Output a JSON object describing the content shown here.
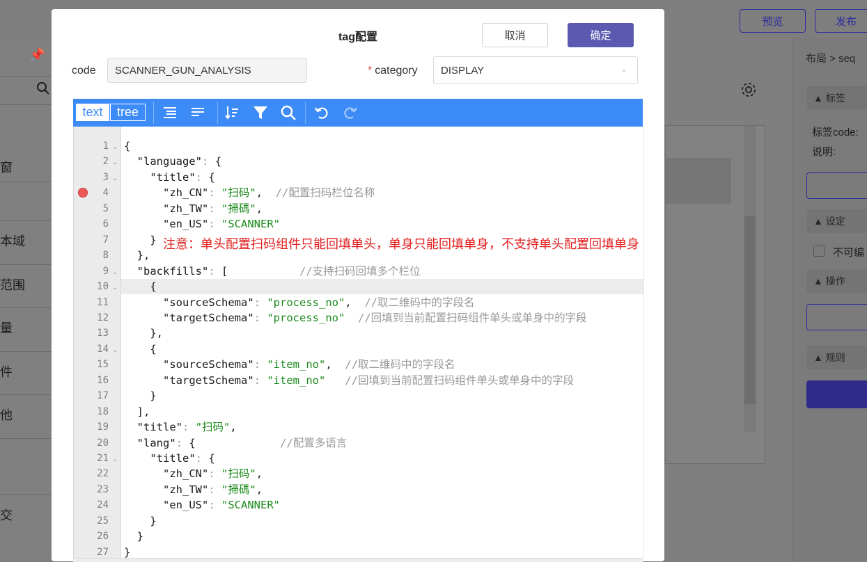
{
  "background": {
    "top_buttons": [
      "预览",
      "发布"
    ],
    "left_items": [
      "窗",
      "本域",
      "范围",
      "量",
      "件",
      "他",
      "交"
    ],
    "right_panel": {
      "breadcrumb": "布局 > seq",
      "sections": [
        "标签",
        "设定",
        "操作",
        "规则"
      ],
      "tag_code_label": "标签code:",
      "desc_label": "说明:",
      "checkbox_label": "不可编"
    }
  },
  "modal": {
    "title": "tag配置",
    "cancel_label": "取消",
    "ok_label": "确定",
    "code_label": "code",
    "code_value": "SCANNER_GUN_ANALYSIS",
    "category_label": "category",
    "category_value": "DISPLAY"
  },
  "editor": {
    "modes": [
      "text",
      "tree"
    ],
    "toolbar_icons": [
      "format-icon",
      "compact-icon",
      "sort-icon",
      "filter-icon",
      "search-icon",
      "undo-icon",
      "redo-icon"
    ],
    "note": "注意：单头配置扫码组件只能回填单头，单身只能回填单身，不支持单头配置回填单身",
    "lines": [
      "{",
      "  \"language\": {",
      "    \"title\": {",
      "      \"zh_CN\": \"扫码\",  //配置扫码栏位名称",
      "      \"zh_TW\": \"掃碼\",",
      "      \"en_US\": \"SCANNER\"",
      "    }",
      "  },",
      "  \"backfills\": [           //支持扫码回填多个栏位",
      "    {",
      "      \"sourceSchema\": \"process_no\",  //取二维码中的字段名",
      "      \"targetSchema\": \"process_no\"  //回填到当前配置扫码组件单头或单身中的字段",
      "    },",
      "    {",
      "      \"sourceSchema\": \"item_no\",  //取二维码中的字段名",
      "      \"targetSchema\": \"item_no\"   //回填到当前配置扫码组件单头或单身中的字段",
      "    }",
      "  ],",
      "  \"title\": \"扫码\",",
      "  \"lang\": {             //配置多语言",
      "    \"title\": {",
      "      \"zh_CN\": \"扫码\",",
      "      \"zh_TW\": \"掃碼\",",
      "      \"en_US\": \"SCANNER\"",
      "    }",
      "  }",
      "}"
    ],
    "line_numbers": [
      "1",
      "2",
      "3",
      "4",
      "5",
      "6",
      "7",
      "8",
      "9",
      "10",
      "11",
      "12",
      "13",
      "14",
      "15",
      "16",
      "17",
      "18",
      "19",
      "20",
      "21",
      "22",
      "23",
      "24",
      "25",
      "26",
      "27"
    ],
    "fold_lines": [
      1,
      2,
      3,
      9,
      10,
      14,
      21
    ],
    "marker_line": 4,
    "highlight_line": 10,
    "colors": {
      "toolbar": "#3d8bf7",
      "string": "#1a8a1a",
      "comment": "#999999",
      "note": "#e02020",
      "primary": "#5c5ab0"
    }
  }
}
